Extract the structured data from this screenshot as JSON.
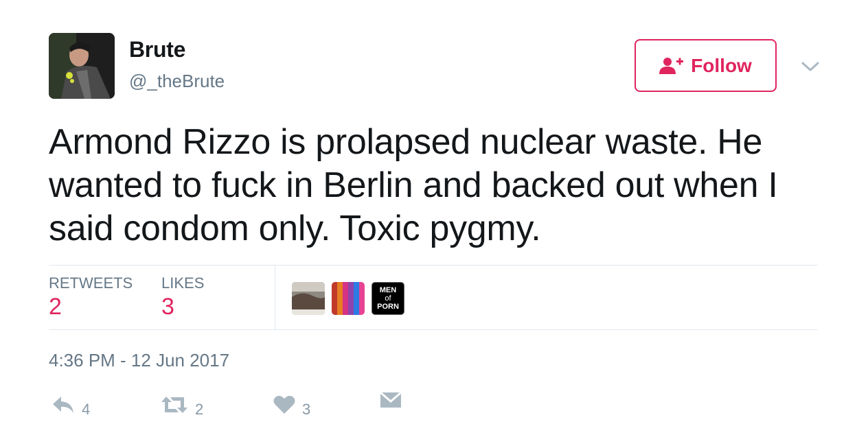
{
  "user": {
    "name": "Brute",
    "handle": "@_theBrute"
  },
  "follow_button": {
    "label": "Follow"
  },
  "tweet": {
    "text": "Armond Rizzo is prolapsed nuclear waste. He wanted to fuck in Berlin and backed out when I said condom only. Toxic pygmy.",
    "timestamp": "4:36 PM - 12 Jun 2017"
  },
  "stats": {
    "retweets_label": "RETWEETS",
    "retweets_value": "2",
    "likes_label": "LIKES",
    "likes_value": "3"
  },
  "likers": [
    {
      "icon": "avatar-photo"
    },
    {
      "icon": "avatar-rainbow"
    },
    {
      "icon": "avatar-logo",
      "text": [
        "MEN",
        "of",
        "PORN"
      ]
    }
  ],
  "actions": {
    "reply_count": "4",
    "retweet_count": "2",
    "like_count": "3"
  },
  "colors": {
    "accent": "#e0245e",
    "secondary_text": "#657786",
    "action_icon": "#aab8c2",
    "divider": "#e1e8ed"
  }
}
